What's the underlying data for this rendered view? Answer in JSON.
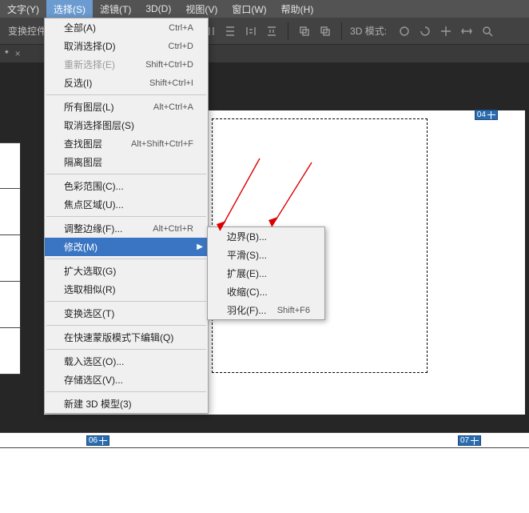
{
  "menubar": {
    "items": [
      {
        "label": "文字(Y)"
      },
      {
        "label": "选择(S)"
      },
      {
        "label": "滤镜(T)"
      },
      {
        "label": "3D(D)"
      },
      {
        "label": "视图(V)"
      },
      {
        "label": "窗口(W)"
      },
      {
        "label": "帮助(H)"
      }
    ]
  },
  "toolbar": {
    "label": "变换控件",
    "mode3d_label": "3D 模式:"
  },
  "tabrow": {
    "star": "*",
    "close": "×"
  },
  "markers": {
    "m04": "04",
    "m06": "06",
    "m07": "07"
  },
  "dropdown": {
    "all": {
      "label": "全部(A)",
      "shortcut": "Ctrl+A"
    },
    "deselect": {
      "label": "取消选择(D)",
      "shortcut": "Ctrl+D"
    },
    "reselect": {
      "label": "重新选择(E)",
      "shortcut": "Shift+Ctrl+D"
    },
    "inverse": {
      "label": "反选(I)",
      "shortcut": "Shift+Ctrl+I"
    },
    "all_layers": {
      "label": "所有图层(L)",
      "shortcut": "Alt+Ctrl+A"
    },
    "deselect_layers": {
      "label": "取消选择图层(S)"
    },
    "find_layers": {
      "label": "查找图层",
      "shortcut": "Alt+Shift+Ctrl+F"
    },
    "isolate_layers": {
      "label": "隔离图层"
    },
    "color_range": {
      "label": "色彩范围(C)..."
    },
    "focus_area": {
      "label": "焦点区域(U)..."
    },
    "refine_edge": {
      "label": "调整边缘(F)...",
      "shortcut": "Alt+Ctrl+R"
    },
    "modify": {
      "label": "修改(M)"
    },
    "grow": {
      "label": "扩大选取(G)"
    },
    "similar": {
      "label": "选取相似(R)"
    },
    "transform": {
      "label": "变换选区(T)"
    },
    "quickmask": {
      "label": "在快速蒙版模式下编辑(Q)"
    },
    "load": {
      "label": "载入选区(O)..."
    },
    "save": {
      "label": "存储选区(V)..."
    },
    "new3d": {
      "label": "新建 3D 模型(3)"
    }
  },
  "submenu": {
    "border": {
      "label": "边界(B)..."
    },
    "smooth": {
      "label": "平滑(S)..."
    },
    "expand": {
      "label": "扩展(E)..."
    },
    "contract": {
      "label": "收缩(C)..."
    },
    "feather": {
      "label": "羽化(F)...",
      "shortcut": "Shift+F6"
    }
  },
  "watermark": ""
}
